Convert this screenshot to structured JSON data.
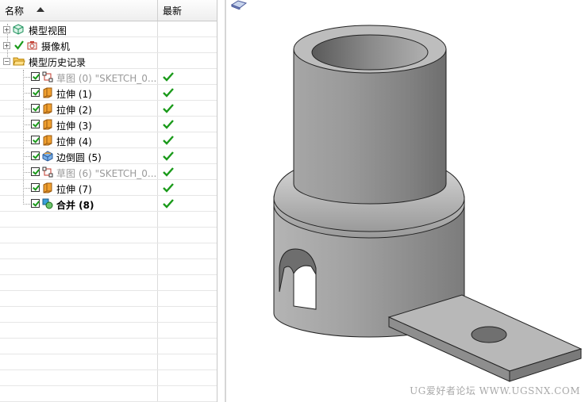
{
  "header": {
    "col_name": "名称",
    "col_latest": "最新"
  },
  "tree": [
    {
      "label": "模型视图",
      "icon": "model-views-icon",
      "expander": "+",
      "indent": 1
    },
    {
      "label": "摄像机",
      "icon": "camera-icon",
      "expander": "+",
      "indent": 1
    },
    {
      "label": "模型历史记录",
      "icon": "folder-open-icon",
      "expander": "−",
      "indent": 1
    },
    {
      "label": "草图 (0) \"SKETCH_0...",
      "icon": "sketch-icon",
      "latest": true,
      "dim": true
    },
    {
      "label": "拉伸 (1)",
      "icon": "extrude-icon",
      "latest": true
    },
    {
      "label": "拉伸 (2)",
      "icon": "extrude-icon",
      "latest": true
    },
    {
      "label": "拉伸 (3)",
      "icon": "extrude-icon",
      "latest": true
    },
    {
      "label": "拉伸 (4)",
      "icon": "extrude-icon",
      "latest": true
    },
    {
      "label": "边倒圆 (5)",
      "icon": "edge-blend-icon",
      "latest": true
    },
    {
      "label": "草图 (6) \"SKETCH_0...",
      "icon": "sketch-icon",
      "latest": true,
      "dim": true
    },
    {
      "label": "拉伸 (7)",
      "icon": "extrude-icon",
      "latest": true
    },
    {
      "label": "合并 (8)",
      "icon": "unite-icon",
      "latest": true,
      "bold": true
    }
  ],
  "watermark": "UG爱好者论坛 WWW.UGSNX.COM",
  "colors": {
    "check_green": "#1a9a1a",
    "part_gray": "#8a8a8a"
  }
}
